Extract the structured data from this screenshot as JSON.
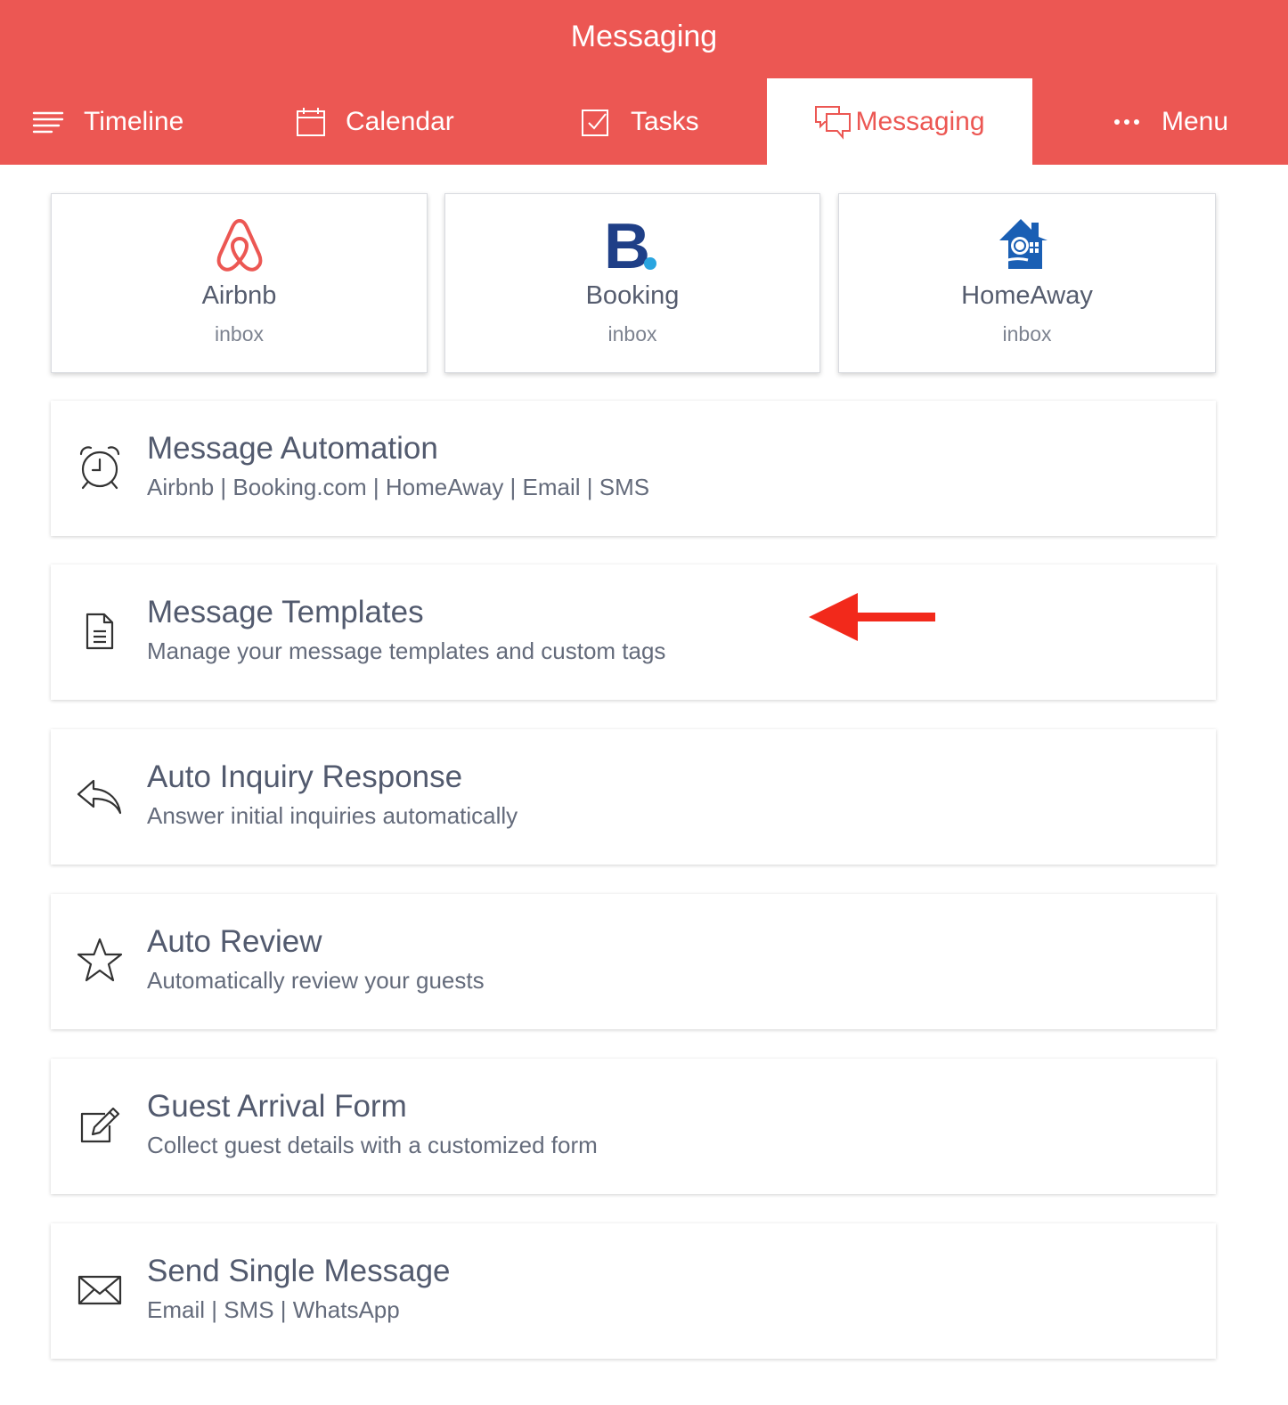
{
  "header": {
    "title": "Messaging",
    "color": "#ec5753"
  },
  "tabs": {
    "timeline": {
      "label": "Timeline",
      "icon": "list-lines-icon"
    },
    "calendar": {
      "label": "Calendar",
      "icon": "calendar-icon"
    },
    "tasks": {
      "label": "Tasks",
      "icon": "checkbox-icon"
    },
    "messaging": {
      "label": "Messaging",
      "icon": "chat-bubbles-icon",
      "active": true
    },
    "menu": {
      "label": "Menu",
      "icon": "ellipsis-icon"
    }
  },
  "inboxes": [
    {
      "name": "Airbnb",
      "sub": "inbox",
      "icon": "airbnb-logo-icon",
      "color": "#ec5753"
    },
    {
      "name": "Booking",
      "sub": "inbox",
      "icon": "booking-logo-icon",
      "color": "#1f3f87"
    },
    {
      "name": "HomeAway",
      "sub": "inbox",
      "icon": "homeaway-logo-icon",
      "color": "#1a5fb4"
    }
  ],
  "features": [
    {
      "title": "Message Automation",
      "sub": "Airbnb | Booking.com | HomeAway | Email | SMS",
      "icon": "alarm-clock-icon"
    },
    {
      "title": "Message Templates",
      "sub": "Manage your message templates and custom tags",
      "icon": "document-icon"
    },
    {
      "title": "Auto Inquiry Response",
      "sub": "Answer initial inquiries automatically",
      "icon": "reply-icon"
    },
    {
      "title": "Auto Review",
      "sub": "Automatically review your guests",
      "icon": "star-icon"
    },
    {
      "title": "Guest Arrival Form",
      "sub": "Collect guest details with a customized form",
      "icon": "edit-icon"
    },
    {
      "title": "Send Single Message",
      "sub": "Email | SMS | WhatsApp",
      "icon": "envelope-icon"
    }
  ],
  "annotation": {
    "icon": "red-arrow-icon",
    "color": "#f2291b"
  }
}
